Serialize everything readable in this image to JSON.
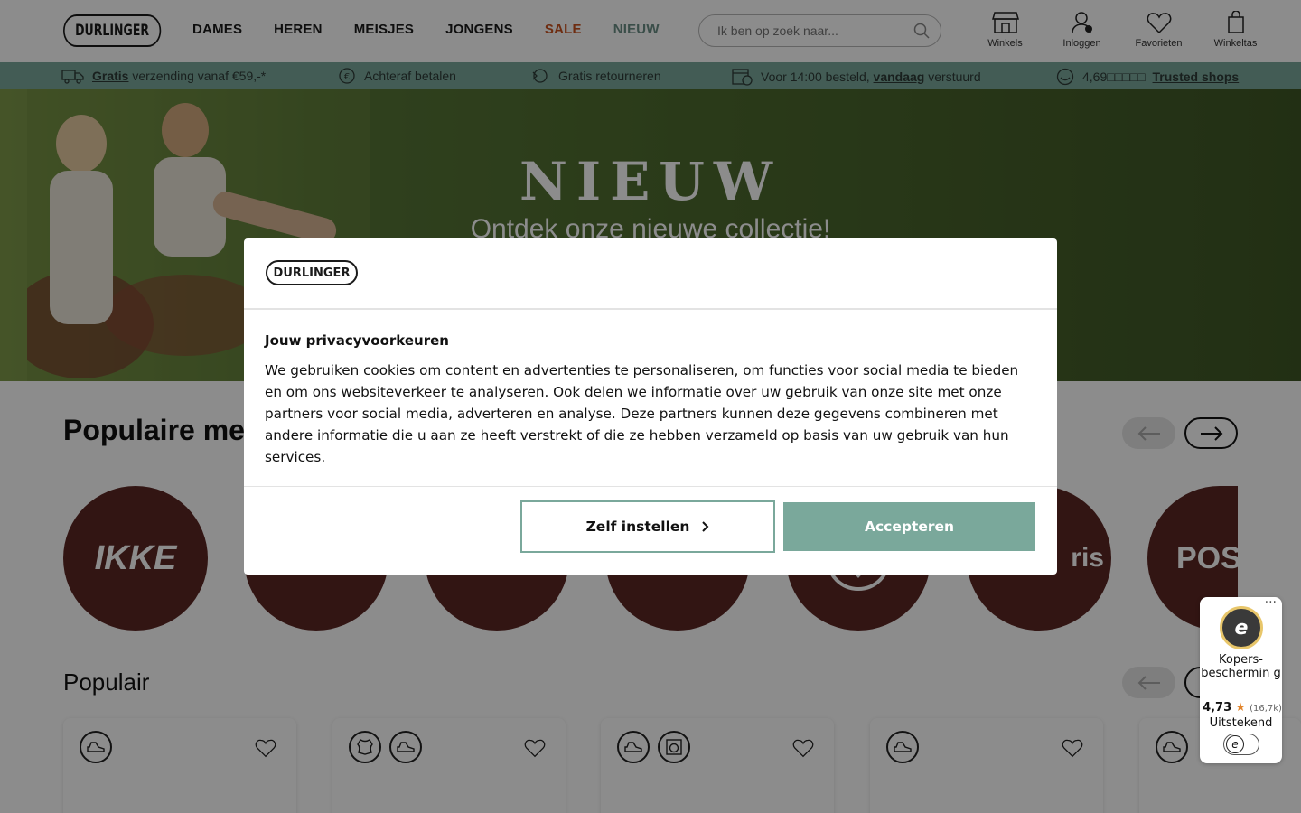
{
  "header": {
    "logo": "DURLINGER",
    "nav": [
      "DAMES",
      "HEREN",
      "MEISJES",
      "JONGENS",
      "SALE",
      "NIEUW"
    ],
    "search_placeholder": "Ik ben op zoek naar...",
    "icons": [
      {
        "label": "Winkels",
        "icon": "store-icon"
      },
      {
        "label": "Inloggen",
        "icon": "user-icon"
      },
      {
        "label": "Favorieten",
        "icon": "heart-icon"
      },
      {
        "label": "Winkeltas",
        "icon": "bag-icon"
      }
    ]
  },
  "usp": {
    "shipping_bold": "Gratis",
    "shipping_rest": "verzending vanaf €59,-*",
    "pay_later": "Achteraf betalen",
    "returns": "Gratis retourneren",
    "delivery_pre": "Voor 14:00 besteld,",
    "delivery_bold": "vandaag",
    "delivery_post": "verstuurd",
    "rating": "4,69□□□□□",
    "trusted_shops": "Trusted shops"
  },
  "hero": {
    "title": "NIEUW",
    "subtitle": "Ontdek onze nieuwe collectie!"
  },
  "sections": {
    "brands_title": "Populaire me",
    "popular_title": "Populair"
  },
  "brands": [
    "IKKE",
    "",
    "",
    "",
    "",
    "ris",
    "POS"
  ],
  "modal": {
    "logo": "DURLINGER",
    "title": "Jouw privacyvoorkeuren",
    "body": "We gebruiken cookies om content en advertenties te personaliseren, om functies voor social media te bieden en om ons websiteverkeer te analyseren. Ook delen we informatie over uw gebruik van onze site met onze partners voor social media, adverteren en analyse. Deze partners kunnen deze gegevens combineren met andere informatie die u aan ze heeft verstrekt of die ze hebben verzameld op basis van uw gebruik van hun services.",
    "settings_button": "Zelf instellen",
    "accept_button": "Accepteren"
  },
  "trusted_widget": {
    "label": "Kopers-beschermin g",
    "score": "4,73",
    "count": "(16,7k)",
    "verdict": "Uitstekend"
  },
  "colors": {
    "accent_green": "#7aa89b",
    "sale_orange": "#c8501e",
    "brand_brown": "#5c2723"
  }
}
